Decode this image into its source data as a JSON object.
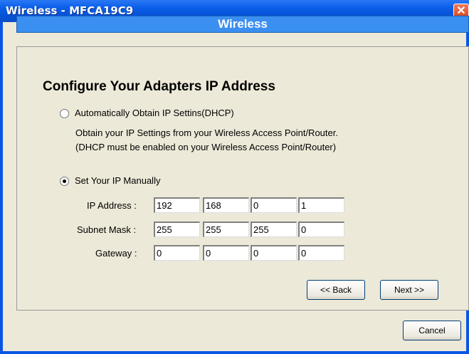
{
  "window": {
    "title": "Wireless - MFCA19C9",
    "close_glyph": "✕"
  },
  "banner": {
    "text": "Wireless"
  },
  "heading": "Configure Your Adapters IP Address",
  "dhcp": {
    "label": "Automatically Obtain IP Settins(DHCP)",
    "desc1": "Obtain your IP Settings from your Wireless Access Point/Router.",
    "desc2": "(DHCP must be enabled on your Wireless Access Point/Router)",
    "selected": false
  },
  "manual": {
    "label": "Set Your IP Manually",
    "selected": true
  },
  "ip_address": {
    "label": "IP Address :",
    "octets": [
      "192",
      "168",
      "0",
      "1"
    ]
  },
  "subnet_mask": {
    "label": "Subnet Mask :",
    "octets": [
      "255",
      "255",
      "255",
      "0"
    ]
  },
  "gateway": {
    "label": "Gateway :",
    "octets": [
      "0",
      "0",
      "0",
      "0"
    ]
  },
  "buttons": {
    "back": "<< Back",
    "next": "Next >>",
    "cancel": "Cancel"
  }
}
